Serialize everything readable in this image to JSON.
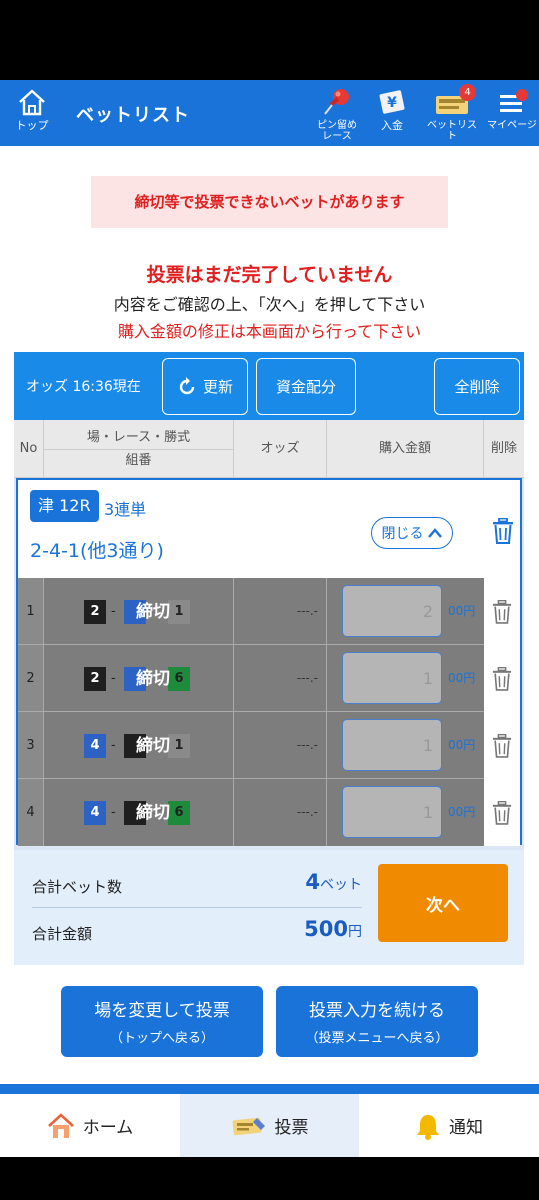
{
  "header": {
    "home_label": "トップ",
    "title": "ベットリスト",
    "pin_label_1": "ピン留め",
    "pin_label_2": "レース",
    "deposit_label": "入金",
    "betlist_label": "ベットリスト",
    "betlist_badge": "4",
    "mypage_label": "マイページ"
  },
  "alert": {
    "box": "締切等で投票できないベットがあります",
    "main": "投票はまだ完了していません",
    "sub": "内容をご確認の上、「次へ」を押して下さい",
    "warn": "購入金額の修正は本画面から行って下さい"
  },
  "toolbar": {
    "odds_time": "オッズ 16:36現在",
    "refresh": "更新",
    "allocate": "資金配分",
    "delete_all": "全削除"
  },
  "columns": {
    "no": "No",
    "race": "場・レース・勝式",
    "combo": "組番",
    "odds": "オッズ",
    "amount": "購入金額",
    "delete": "削除"
  },
  "race": {
    "tag": "津 12R",
    "type": "3連単",
    "combo": "2-4-1(他3通り)",
    "close": "閉じる"
  },
  "bets": [
    {
      "no": "1",
      "boats": [
        "2",
        "",
        "1"
      ],
      "closed": "締切",
      "odds": "---.-",
      "amount": "2",
      "unit": "00円"
    },
    {
      "no": "2",
      "boats": [
        "2",
        "",
        "6"
      ],
      "closed": "締切",
      "odds": "---.-",
      "amount": "1",
      "unit": "00円"
    },
    {
      "no": "3",
      "boats": [
        "4",
        "",
        "1"
      ],
      "closed": "締切",
      "odds": "---.-",
      "amount": "1",
      "unit": "00円"
    },
    {
      "no": "4",
      "boats": [
        "4",
        "",
        "6"
      ],
      "closed": "締切",
      "odds": "---.-",
      "amount": "1",
      "unit": "00円"
    }
  ],
  "summary": {
    "bet_count_label": "合計ベット数",
    "bet_count": "4",
    "bet_count_unit": "ベット",
    "total_label": "合計金額",
    "total": "500",
    "total_unit": "円",
    "next": "次へ"
  },
  "actions": {
    "change_main": "場を変更して投票",
    "change_sub": "（トップへ戻る）",
    "continue_main": "投票入力を続ける",
    "continue_sub": "（投票メニューへ戻る）"
  },
  "footer": {
    "home": "ホーム",
    "vote": "投票",
    "notify": "通知"
  },
  "colors": {
    "brand_blue": "#1a73d8",
    "alert_red": "#e02020",
    "next_orange": "#f08a00",
    "boat_1": "#ffffff",
    "boat_2": "#1f1f1f",
    "boat_4": "#2b62c4",
    "boat_6": "#1e8a3c"
  },
  "icons": [
    "home-icon",
    "pin-icon",
    "deposit-icon",
    "ticket-icon",
    "menu-icon",
    "refresh-icon",
    "trash-icon",
    "chevron-up-icon",
    "house-icon",
    "bell-icon"
  ]
}
